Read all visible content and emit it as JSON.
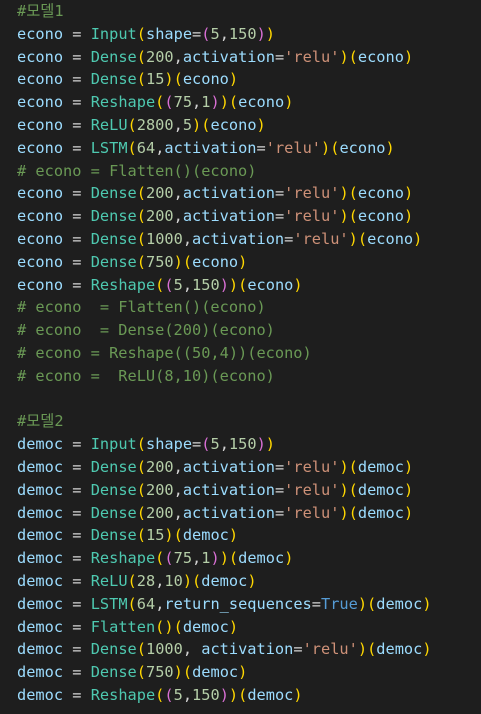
{
  "editor": {
    "lines": [
      [
        [
          "comment",
          "#모델1"
        ]
      ],
      [
        [
          "var",
          "econo"
        ],
        [
          "plain",
          " = "
        ],
        [
          "class",
          "Input"
        ],
        [
          "paren1",
          "("
        ],
        [
          "var",
          "shape"
        ],
        [
          "plain",
          "="
        ],
        [
          "paren2",
          "("
        ],
        [
          "num",
          "5"
        ],
        [
          "plain",
          ","
        ],
        [
          "num",
          "150"
        ],
        [
          "paren2",
          ")"
        ],
        [
          "paren1",
          ")"
        ]
      ],
      [
        [
          "var",
          "econo"
        ],
        [
          "plain",
          " = "
        ],
        [
          "class",
          "Dense"
        ],
        [
          "paren1",
          "("
        ],
        [
          "num",
          "200"
        ],
        [
          "plain",
          ","
        ],
        [
          "var",
          "activation"
        ],
        [
          "plain",
          "="
        ],
        [
          "str",
          "'relu'"
        ],
        [
          "paren1",
          ")"
        ],
        [
          "paren1",
          "("
        ],
        [
          "var",
          "econo"
        ],
        [
          "paren1",
          ")"
        ]
      ],
      [
        [
          "var",
          "econo"
        ],
        [
          "plain",
          " = "
        ],
        [
          "class",
          "Dense"
        ],
        [
          "paren1",
          "("
        ],
        [
          "num",
          "15"
        ],
        [
          "paren1",
          ")"
        ],
        [
          "paren1",
          "("
        ],
        [
          "var",
          "econo"
        ],
        [
          "paren1",
          ")"
        ]
      ],
      [
        [
          "var",
          "econo"
        ],
        [
          "plain",
          " = "
        ],
        [
          "class",
          "Reshape"
        ],
        [
          "paren1",
          "("
        ],
        [
          "paren2",
          "("
        ],
        [
          "num",
          "75"
        ],
        [
          "plain",
          ","
        ],
        [
          "num",
          "1"
        ],
        [
          "paren2",
          ")"
        ],
        [
          "paren1",
          ")"
        ],
        [
          "paren1",
          "("
        ],
        [
          "var",
          "econo"
        ],
        [
          "paren1",
          ")"
        ]
      ],
      [
        [
          "var",
          "econo"
        ],
        [
          "plain",
          " = "
        ],
        [
          "class",
          "ReLU"
        ],
        [
          "paren1",
          "("
        ],
        [
          "num",
          "2800"
        ],
        [
          "plain",
          ","
        ],
        [
          "num",
          "5"
        ],
        [
          "paren1",
          ")"
        ],
        [
          "paren1",
          "("
        ],
        [
          "var",
          "econo"
        ],
        [
          "paren1",
          ")"
        ]
      ],
      [
        [
          "var",
          "econo"
        ],
        [
          "plain",
          " = "
        ],
        [
          "class",
          "LSTM"
        ],
        [
          "paren1",
          "("
        ],
        [
          "num",
          "64"
        ],
        [
          "plain",
          ","
        ],
        [
          "var",
          "activation"
        ],
        [
          "plain",
          "="
        ],
        [
          "str",
          "'relu'"
        ],
        [
          "paren1",
          ")"
        ],
        [
          "paren1",
          "("
        ],
        [
          "var",
          "econo"
        ],
        [
          "paren1",
          ")"
        ]
      ],
      [
        [
          "comment",
          "# econo = Flatten()(econo)"
        ]
      ],
      [
        [
          "var",
          "econo"
        ],
        [
          "plain",
          " = "
        ],
        [
          "class",
          "Dense"
        ],
        [
          "paren1",
          "("
        ],
        [
          "num",
          "200"
        ],
        [
          "plain",
          ","
        ],
        [
          "var",
          "activation"
        ],
        [
          "plain",
          "="
        ],
        [
          "str",
          "'relu'"
        ],
        [
          "paren1",
          ")"
        ],
        [
          "paren1",
          "("
        ],
        [
          "var",
          "econo"
        ],
        [
          "paren1",
          ")"
        ]
      ],
      [
        [
          "var",
          "econo"
        ],
        [
          "plain",
          " = "
        ],
        [
          "class",
          "Dense"
        ],
        [
          "paren1",
          "("
        ],
        [
          "num",
          "200"
        ],
        [
          "plain",
          ","
        ],
        [
          "var",
          "activation"
        ],
        [
          "plain",
          "="
        ],
        [
          "str",
          "'relu'"
        ],
        [
          "paren1",
          ")"
        ],
        [
          "paren1",
          "("
        ],
        [
          "var",
          "econo"
        ],
        [
          "paren1",
          ")"
        ]
      ],
      [
        [
          "var",
          "econo"
        ],
        [
          "plain",
          " = "
        ],
        [
          "class",
          "Dense"
        ],
        [
          "paren1",
          "("
        ],
        [
          "num",
          "1000"
        ],
        [
          "plain",
          ","
        ],
        [
          "var",
          "activation"
        ],
        [
          "plain",
          "="
        ],
        [
          "str",
          "'relu'"
        ],
        [
          "paren1",
          ")"
        ],
        [
          "paren1",
          "("
        ],
        [
          "var",
          "econo"
        ],
        [
          "paren1",
          ")"
        ]
      ],
      [
        [
          "var",
          "econo"
        ],
        [
          "plain",
          " = "
        ],
        [
          "class",
          "Dense"
        ],
        [
          "paren1",
          "("
        ],
        [
          "num",
          "750"
        ],
        [
          "paren1",
          ")"
        ],
        [
          "paren1",
          "("
        ],
        [
          "var",
          "econo"
        ],
        [
          "paren1",
          ")"
        ]
      ],
      [
        [
          "var",
          "econo"
        ],
        [
          "plain",
          " = "
        ],
        [
          "class",
          "Reshape"
        ],
        [
          "paren1",
          "("
        ],
        [
          "paren2",
          "("
        ],
        [
          "num",
          "5"
        ],
        [
          "plain",
          ","
        ],
        [
          "num",
          "150"
        ],
        [
          "paren2",
          ")"
        ],
        [
          "paren1",
          ")"
        ],
        [
          "paren1",
          "("
        ],
        [
          "var",
          "econo"
        ],
        [
          "paren1",
          ")"
        ]
      ],
      [
        [
          "comment",
          "# econo  = Flatten()(econo)"
        ]
      ],
      [
        [
          "comment",
          "# econo  = Dense(200)(econo)"
        ]
      ],
      [
        [
          "comment",
          "# econo = Reshape((50,4))(econo)"
        ]
      ],
      [
        [
          "comment",
          "# econo =  ReLU(8,10)(econo)"
        ]
      ],
      [],
      [
        [
          "comment",
          "#모델2"
        ]
      ],
      [
        [
          "var",
          "democ"
        ],
        [
          "plain",
          " = "
        ],
        [
          "class",
          "Input"
        ],
        [
          "paren1",
          "("
        ],
        [
          "var",
          "shape"
        ],
        [
          "plain",
          "="
        ],
        [
          "paren2",
          "("
        ],
        [
          "num",
          "5"
        ],
        [
          "plain",
          ","
        ],
        [
          "num",
          "150"
        ],
        [
          "paren2",
          ")"
        ],
        [
          "paren1",
          ")"
        ]
      ],
      [
        [
          "var",
          "democ"
        ],
        [
          "plain",
          " = "
        ],
        [
          "class",
          "Dense"
        ],
        [
          "paren1",
          "("
        ],
        [
          "num",
          "200"
        ],
        [
          "plain",
          ","
        ],
        [
          "var",
          "activation"
        ],
        [
          "plain",
          "="
        ],
        [
          "str",
          "'relu'"
        ],
        [
          "paren1",
          ")"
        ],
        [
          "paren1",
          "("
        ],
        [
          "var",
          "democ"
        ],
        [
          "paren1",
          ")"
        ]
      ],
      [
        [
          "var",
          "democ"
        ],
        [
          "plain",
          " = "
        ],
        [
          "class",
          "Dense"
        ],
        [
          "paren1",
          "("
        ],
        [
          "num",
          "200"
        ],
        [
          "plain",
          ","
        ],
        [
          "var",
          "activation"
        ],
        [
          "plain",
          "="
        ],
        [
          "str",
          "'relu'"
        ],
        [
          "paren1",
          ")"
        ],
        [
          "paren1",
          "("
        ],
        [
          "var",
          "democ"
        ],
        [
          "paren1",
          ")"
        ]
      ],
      [
        [
          "var",
          "democ"
        ],
        [
          "plain",
          " = "
        ],
        [
          "class",
          "Dense"
        ],
        [
          "paren1",
          "("
        ],
        [
          "num",
          "200"
        ],
        [
          "plain",
          ","
        ],
        [
          "var",
          "activation"
        ],
        [
          "plain",
          "="
        ],
        [
          "str",
          "'relu'"
        ],
        [
          "paren1",
          ")"
        ],
        [
          "paren1",
          "("
        ],
        [
          "var",
          "democ"
        ],
        [
          "paren1",
          ")"
        ]
      ],
      [
        [
          "var",
          "democ"
        ],
        [
          "plain",
          " = "
        ],
        [
          "class",
          "Dense"
        ],
        [
          "paren1",
          "("
        ],
        [
          "num",
          "15"
        ],
        [
          "paren1",
          ")"
        ],
        [
          "paren1",
          "("
        ],
        [
          "var",
          "democ"
        ],
        [
          "paren1",
          ")"
        ]
      ],
      [
        [
          "var",
          "democ"
        ],
        [
          "plain",
          " = "
        ],
        [
          "class",
          "Reshape"
        ],
        [
          "paren1",
          "("
        ],
        [
          "paren2",
          "("
        ],
        [
          "num",
          "75"
        ],
        [
          "plain",
          ","
        ],
        [
          "num",
          "1"
        ],
        [
          "paren2",
          ")"
        ],
        [
          "paren1",
          ")"
        ],
        [
          "paren1",
          "("
        ],
        [
          "var",
          "democ"
        ],
        [
          "paren1",
          ")"
        ]
      ],
      [
        [
          "var",
          "democ"
        ],
        [
          "plain",
          " = "
        ],
        [
          "class",
          "ReLU"
        ],
        [
          "paren1",
          "("
        ],
        [
          "num",
          "28"
        ],
        [
          "plain",
          ","
        ],
        [
          "num",
          "10"
        ],
        [
          "paren1",
          ")"
        ],
        [
          "paren1",
          "("
        ],
        [
          "var",
          "democ"
        ],
        [
          "paren1",
          ")"
        ]
      ],
      [
        [
          "var",
          "democ"
        ],
        [
          "plain",
          " = "
        ],
        [
          "class",
          "LSTM"
        ],
        [
          "paren1",
          "("
        ],
        [
          "num",
          "64"
        ],
        [
          "plain",
          ","
        ],
        [
          "var",
          "return_sequences"
        ],
        [
          "plain",
          "="
        ],
        [
          "kw",
          "True"
        ],
        [
          "paren1",
          ")"
        ],
        [
          "paren1",
          "("
        ],
        [
          "var",
          "democ"
        ],
        [
          "paren1",
          ")"
        ]
      ],
      [
        [
          "var",
          "democ"
        ],
        [
          "plain",
          " = "
        ],
        [
          "class",
          "Flatten"
        ],
        [
          "paren1",
          "("
        ],
        [
          "paren1",
          ")"
        ],
        [
          "paren1",
          "("
        ],
        [
          "var",
          "democ"
        ],
        [
          "paren1",
          ")"
        ]
      ],
      [
        [
          "var",
          "democ"
        ],
        [
          "plain",
          " = "
        ],
        [
          "class",
          "Dense"
        ],
        [
          "paren1",
          "("
        ],
        [
          "num",
          "1000"
        ],
        [
          "plain",
          ", "
        ],
        [
          "var",
          "activation"
        ],
        [
          "plain",
          "="
        ],
        [
          "str",
          "'relu'"
        ],
        [
          "paren1",
          ")"
        ],
        [
          "paren1",
          "("
        ],
        [
          "var",
          "democ"
        ],
        [
          "paren1",
          ")"
        ]
      ],
      [
        [
          "var",
          "democ"
        ],
        [
          "plain",
          " = "
        ],
        [
          "class",
          "Dense"
        ],
        [
          "paren1",
          "("
        ],
        [
          "num",
          "750"
        ],
        [
          "paren1",
          ")"
        ],
        [
          "paren1",
          "("
        ],
        [
          "var",
          "democ"
        ],
        [
          "paren1",
          ")"
        ]
      ],
      [
        [
          "var",
          "democ"
        ],
        [
          "plain",
          " = "
        ],
        [
          "class",
          "Reshape"
        ],
        [
          "paren1",
          "("
        ],
        [
          "paren2",
          "("
        ],
        [
          "num",
          "5"
        ],
        [
          "plain",
          ","
        ],
        [
          "num",
          "150"
        ],
        [
          "paren2",
          ")"
        ],
        [
          "paren1",
          ")"
        ],
        [
          "paren1",
          "("
        ],
        [
          "var",
          "democ"
        ],
        [
          "paren1",
          ")"
        ]
      ]
    ]
  }
}
